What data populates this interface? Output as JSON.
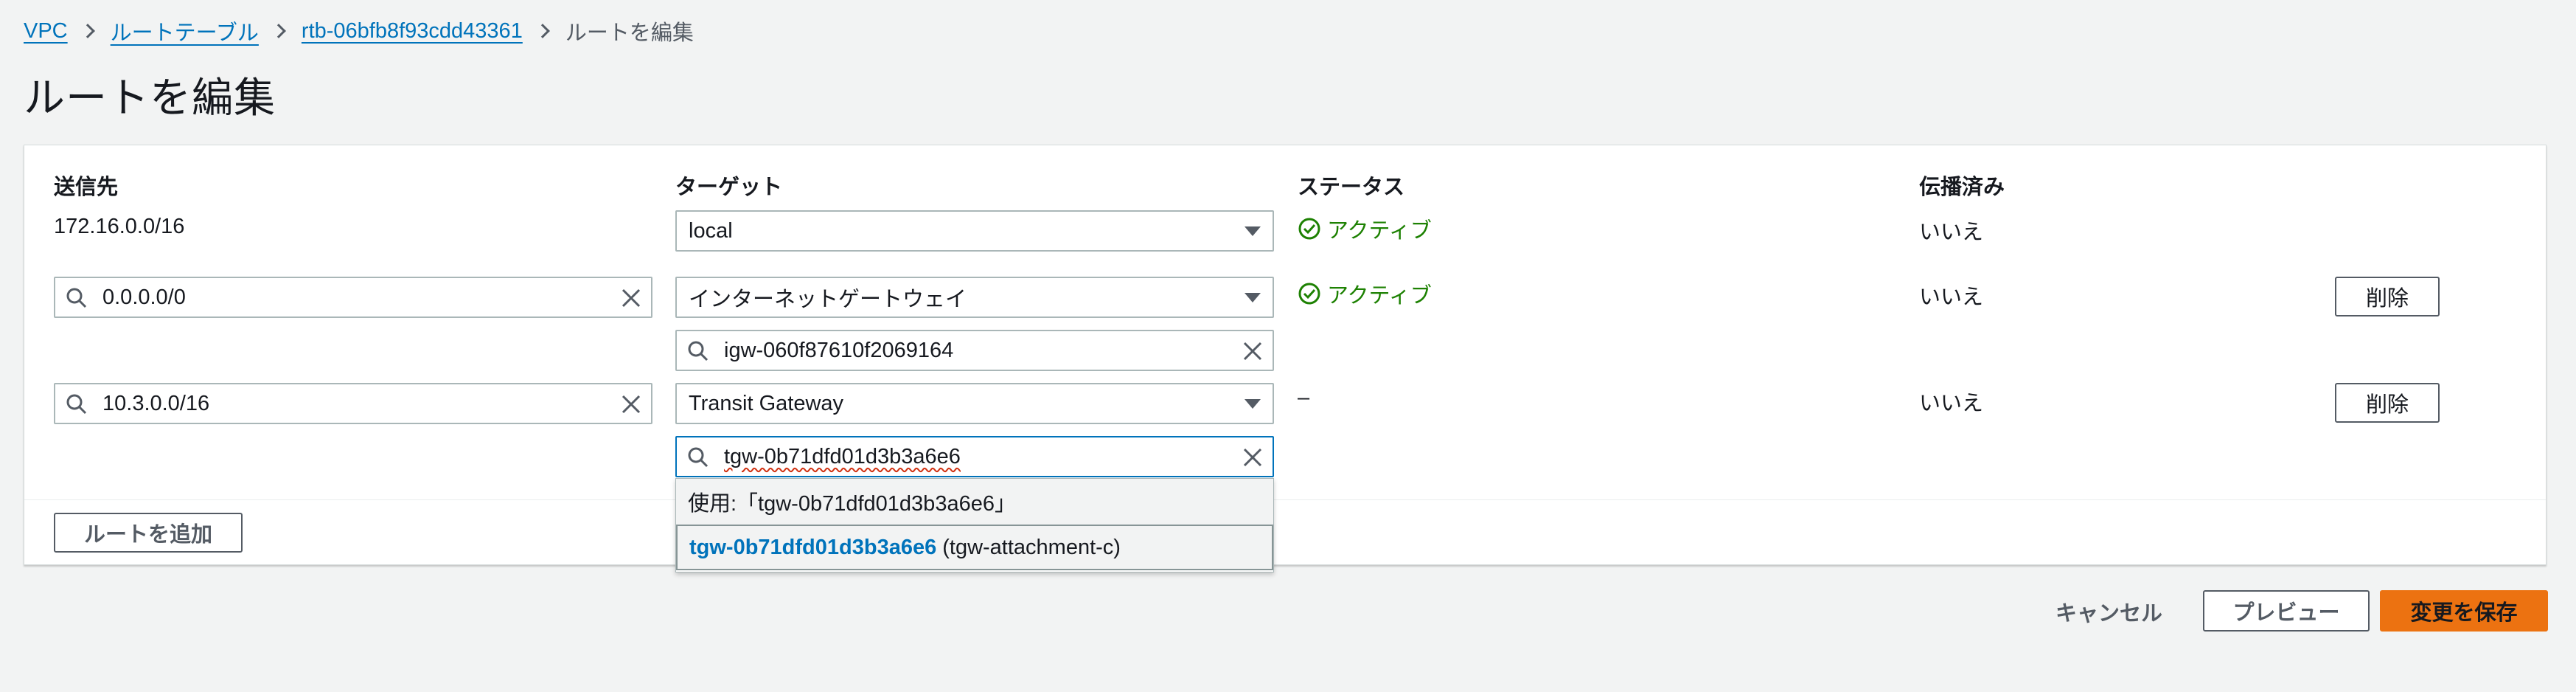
{
  "breadcrumb": {
    "items": [
      "VPC",
      "ルートテーブル",
      "rtb-06bfb8f93cdd43361"
    ],
    "current": "ルートを編集"
  },
  "page_title": "ルートを編集",
  "table": {
    "headers": [
      "送信先",
      "ターゲット",
      "ステータス",
      "伝播済み"
    ],
    "rows": [
      {
        "destination": "172.16.0.0/16",
        "target_type": "local",
        "status": "アクティブ",
        "propagated": "いいえ"
      },
      {
        "destination": "0.0.0.0/0",
        "target_type": "インターネットゲートウェイ",
        "target_id": "igw-060f87610f2069164",
        "status": "アクティブ",
        "propagated": "いいえ",
        "delete_label": "削除"
      },
      {
        "destination": "10.3.0.0/16",
        "target_type": "Transit Gateway",
        "target_id": "tgw-0b71dfd01d3b3a6e6",
        "status": "–",
        "propagated": "いいえ",
        "delete_label": "削除"
      }
    ]
  },
  "dropdown": {
    "use_option": "使用:「tgw-0b71dfd01d3b3a6e6」",
    "option_id": "tgw-0b71dfd01d3b3a6e6",
    "option_name": "(tgw-attachment-c)"
  },
  "add_route_label": "ルートを追加",
  "actions": {
    "cancel": "キャンセル",
    "preview": "プレビュー",
    "save": "変更を保存"
  },
  "colors": {
    "link": "#0073bb",
    "status_active": "#1d8102",
    "primary": "#ec7211"
  }
}
